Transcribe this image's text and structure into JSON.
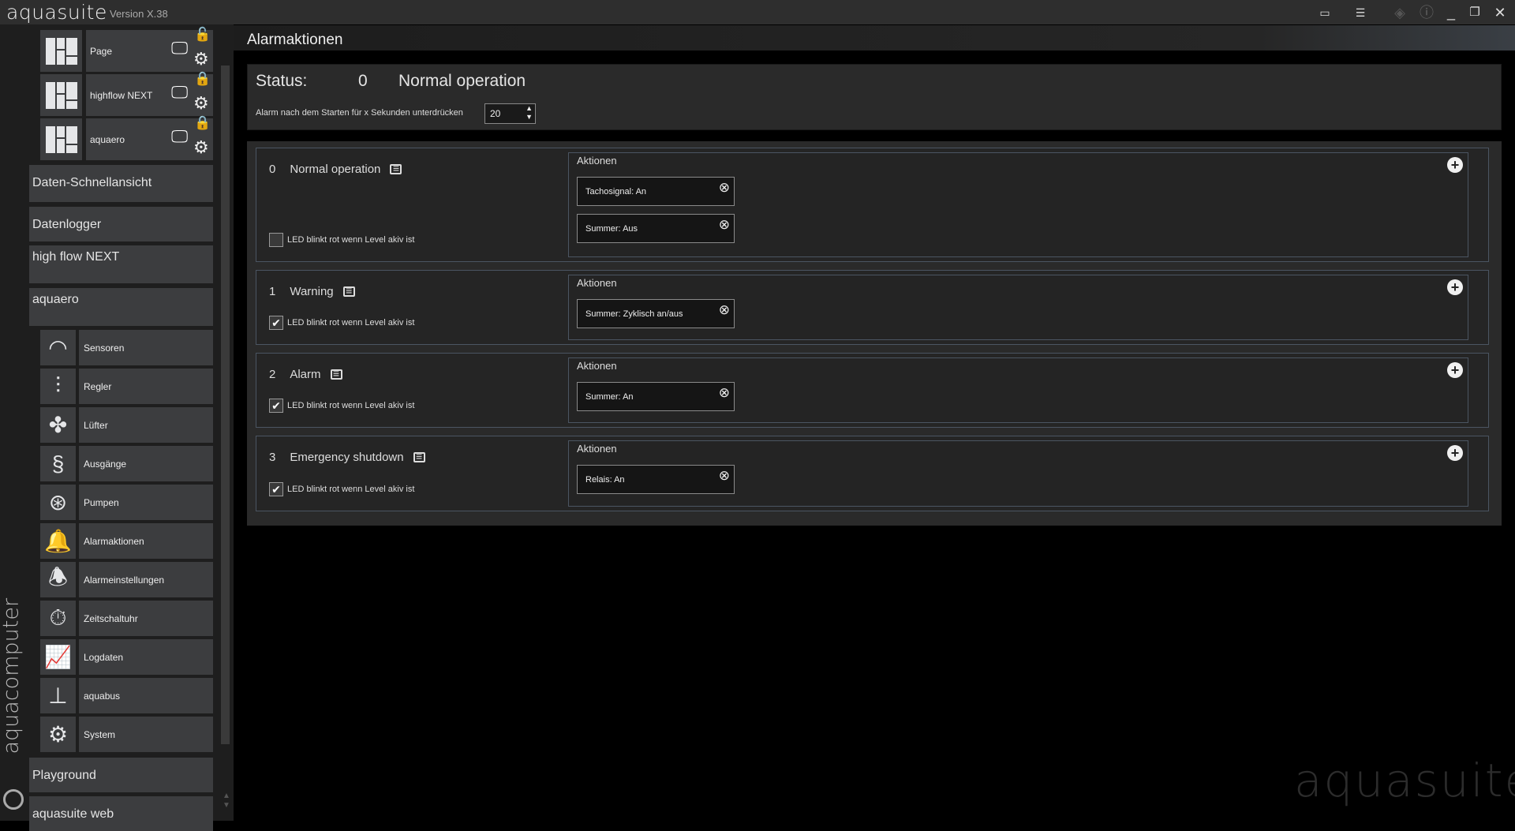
{
  "app": {
    "title": "aquasuite",
    "version": "Version X.38",
    "brand_vertical": "aquacomputer",
    "watermark": "aquasuite"
  },
  "window_controls": [
    "fullscreen-icon",
    "compact-icon",
    "layers-icon",
    "info-icon",
    "minimize-icon",
    "restore-icon",
    "close-icon"
  ],
  "sidebar": {
    "pages": [
      {
        "label": "Page",
        "locked": false
      },
      {
        "label": "highflow NEXT",
        "locked": true
      },
      {
        "label": "aquaero",
        "locked": true
      }
    ],
    "nav": [
      "Daten-Schnellansicht",
      "Datenlogger",
      "high flow NEXT",
      "aquaero"
    ],
    "sub_items": [
      {
        "label": "Sensoren",
        "icon": "gauge-icon"
      },
      {
        "label": "Regler",
        "icon": "sliders-icon"
      },
      {
        "label": "Lüfter",
        "icon": "fan-icon"
      },
      {
        "label": "Ausgänge",
        "icon": "outputs-icon"
      },
      {
        "label": "Pumpen",
        "icon": "pump-icon"
      },
      {
        "label": "Alarmaktionen",
        "icon": "alarm-gear-icon"
      },
      {
        "label": "Alarmeinstellungen",
        "icon": "alarm-bell-icon"
      },
      {
        "label": "Zeitschaltuhr",
        "icon": "timer-icon"
      },
      {
        "label": "Logdaten",
        "icon": "chart-icon"
      },
      {
        "label": "aquabus",
        "icon": "network-icon"
      },
      {
        "label": "System",
        "icon": "gear-icon"
      }
    ],
    "bottom": [
      "Playground",
      "aquasuite web"
    ],
    "accent": "#f0a020"
  },
  "main": {
    "title": "Alarmaktionen",
    "status": {
      "label": "Status:",
      "code": "0",
      "text": "Normal operation"
    },
    "suppress": {
      "label": "Alarm nach dem Starten für x Sekunden unterdrücken",
      "value": "20"
    },
    "actions_label": "Aktionen",
    "led_label": "LED blinkt rot wenn Level akiv ist",
    "levels": [
      {
        "num": "0",
        "name": "Normal operation",
        "led": false,
        "actions": [
          "Tachosignal: An",
          "Summer: Aus"
        ]
      },
      {
        "num": "1",
        "name": "Warning",
        "led": true,
        "actions": [
          "Summer: Zyklisch an/aus"
        ]
      },
      {
        "num": "2",
        "name": "Alarm",
        "led": true,
        "actions": [
          "Summer: An"
        ]
      },
      {
        "num": "3",
        "name": "Emergency shutdown",
        "led": true,
        "actions": [
          "Relais: An"
        ]
      }
    ]
  }
}
